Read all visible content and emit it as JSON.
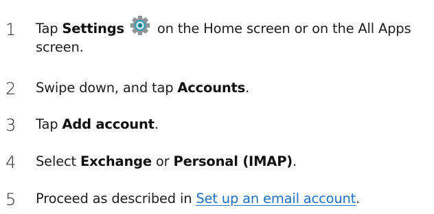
{
  "steps": [
    {
      "number": "1",
      "before": "Tap ",
      "bold": "Settings",
      "icon": "settings-gear-icon",
      "after": " on the Home screen or on the All Apps screen."
    },
    {
      "number": "2",
      "before": "Swipe down, and tap ",
      "bold": "Accounts",
      "after": "."
    },
    {
      "number": "3",
      "before": "Tap ",
      "bold": "Add account",
      "after": "."
    },
    {
      "number": "4",
      "before": "Select ",
      "bold": "Exchange",
      "middle": " or ",
      "bold2": "Personal (IMAP)",
      "after": "."
    },
    {
      "number": "5",
      "before": "Proceed as described in ",
      "link": "Set up an email account",
      "after": "."
    }
  ],
  "colors": {
    "text": "#1e1e1e",
    "link": "#1f6fc4",
    "icon_ring": "#3a9fb0",
    "icon_body": "#8a9096"
  }
}
